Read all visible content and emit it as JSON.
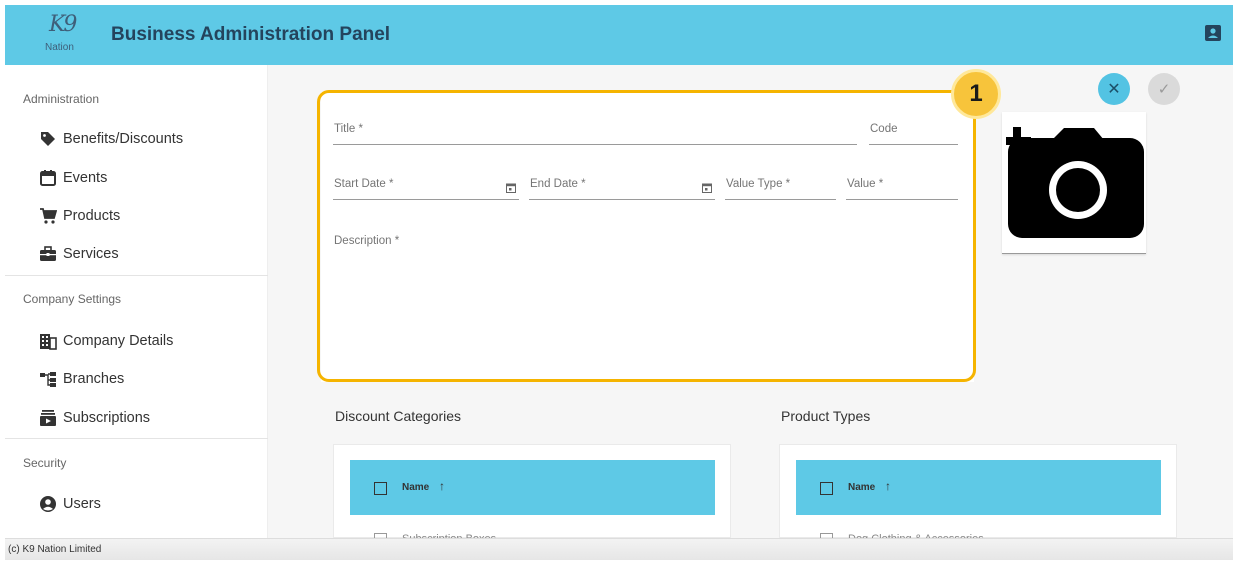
{
  "header": {
    "logo_mark": "K9",
    "logo_text": "Nation",
    "title": "Business Administration Panel",
    "accent_color": "#5ec9e6",
    "icons": [
      "logo",
      "profile-card-icon"
    ]
  },
  "sidebar": {
    "sections": [
      {
        "title": "Administration",
        "items": [
          {
            "label": "Benefits/Discounts",
            "icon": "tag-icon"
          },
          {
            "label": "Events",
            "icon": "calendar-icon"
          },
          {
            "label": "Products",
            "icon": "cart-icon"
          },
          {
            "label": "Services",
            "icon": "briefcase-icon"
          }
        ]
      },
      {
        "title": "Company Settings",
        "items": [
          {
            "label": "Company Details",
            "icon": "domain-icon"
          },
          {
            "label": "Branches",
            "icon": "sitemap-icon"
          },
          {
            "label": "Subscriptions",
            "icon": "subscriptions-icon"
          }
        ]
      },
      {
        "title": "Security",
        "items": [
          {
            "label": "Users",
            "icon": "user-circle-icon"
          }
        ]
      }
    ]
  },
  "form": {
    "title_label": "Title *",
    "code_label": "Code",
    "start_date_label": "Start Date *",
    "end_date_label": "End Date *",
    "value_type_label": "Value Type *",
    "value_label": "Value *",
    "description_label": "Description *",
    "highlight_color": "#f5b400"
  },
  "callout": {
    "number": "1"
  },
  "actions": {
    "cancel_icon": "close-icon",
    "confirm_icon": "check-icon"
  },
  "image_upload": {
    "icon": "add-photo-icon"
  },
  "discount_categories": {
    "title": "Discount Categories",
    "columns": [
      {
        "label": "Name",
        "sort": "ascending"
      }
    ],
    "rows": [
      "Subscription Boxes"
    ]
  },
  "product_types": {
    "title": "Product Types",
    "columns": [
      {
        "label": "Name",
        "sort": "ascending"
      }
    ],
    "rows": [
      "Dog Clothing & Accessories"
    ]
  },
  "footer": {
    "text": "(c) K9 Nation Limited"
  }
}
